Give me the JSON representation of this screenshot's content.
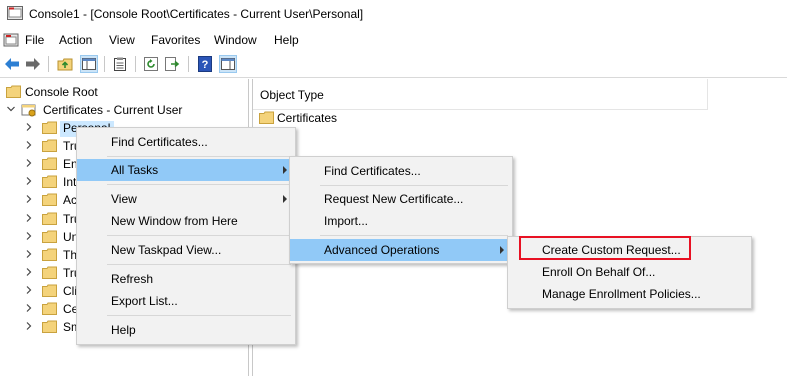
{
  "window": {
    "title": "Console1 - [Console Root\\Certificates - Current User\\Personal]"
  },
  "menubar": [
    "File",
    "Action",
    "View",
    "Favorites",
    "Window",
    "Help"
  ],
  "toolbar": {
    "icons": [
      "back-arrow-icon",
      "forward-arrow-icon",
      "up-folder-icon",
      "show-hide-console-tree-icon",
      "clipboard-icon",
      "refresh-icon",
      "export-list-icon",
      "help-icon",
      "show-hide-action-pane-icon"
    ]
  },
  "tree": {
    "root": "Console Root",
    "snapin": "Certificates - Current User",
    "items": [
      "Personal",
      "Tru",
      "En",
      "Int",
      "Ac",
      "Tru",
      "Un",
      "Th",
      "Tru",
      "Cli",
      "Ce",
      "Sm"
    ]
  },
  "right_pane": {
    "column_header": "Object Type",
    "items": [
      "Certificates"
    ]
  },
  "context_menu": {
    "items": [
      "Find Certificates...",
      "All Tasks",
      "View",
      "New Window from Here",
      "New Taskpad View...",
      "Refresh",
      "Export List...",
      "Help"
    ]
  },
  "all_tasks_menu": {
    "items": [
      "Find Certificates...",
      "Request New Certificate...",
      "Import...",
      "Advanced Operations"
    ]
  },
  "advanced_menu": {
    "items": [
      "Create Custom Request...",
      "Enroll On Behalf Of...",
      "Manage Enrollment Policies..."
    ]
  },
  "colors": {
    "highlight": "#91c9f7",
    "selection": "#cce8ff",
    "callout": "#e81123",
    "folder": "#f4d37b"
  }
}
